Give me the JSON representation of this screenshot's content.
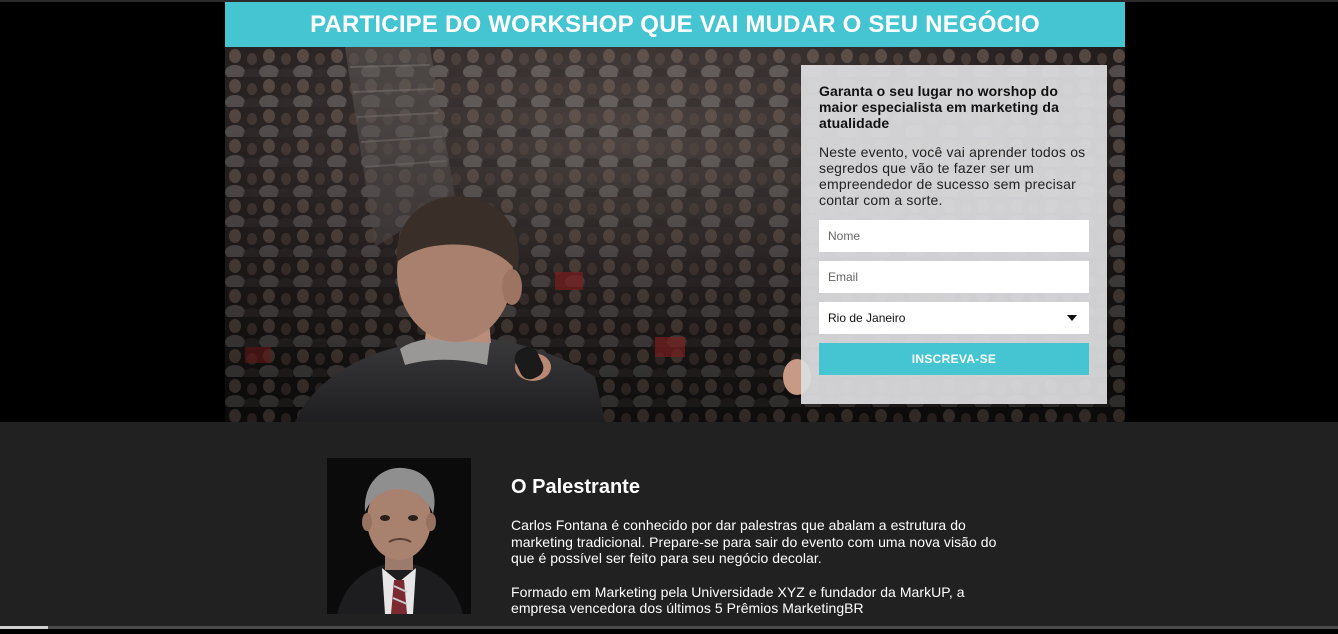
{
  "banner": {
    "title": "PARTICIPE DO WORKSHOP QUE VAI MUDAR O SEU NEGÓCIO"
  },
  "form": {
    "title": "Garanta o seu lugar no worshop do maior especialista em marketing da atualidade",
    "description": "Neste evento, você vai aprender todos os segredos que vão te fazer ser um empreendedor de sucesso sem precisar contar com a sorte.",
    "name_placeholder": "Nome",
    "email_placeholder": "Email",
    "city_selected": "Rio de Janeiro",
    "submit_label": "INSCREVA-SE"
  },
  "speaker": {
    "title": "O Palestrante",
    "bio_1": "Carlos Fontana é conhecido por dar palestras que abalam a estrutura do marketing tradicional. Prepare-se para sair do evento com uma nova visão do que é possível ser feito para seu negócio decolar.",
    "bio_2": "Formado em Marketing pela Universidade XYZ e fundador da MarkUP, a empresa vencedora dos últimos 5 Prêmios MarketingBR"
  },
  "colors": {
    "accent": "#45c4d1",
    "speaker_bg": "#202120",
    "form_card_bg": "#dedee0"
  }
}
